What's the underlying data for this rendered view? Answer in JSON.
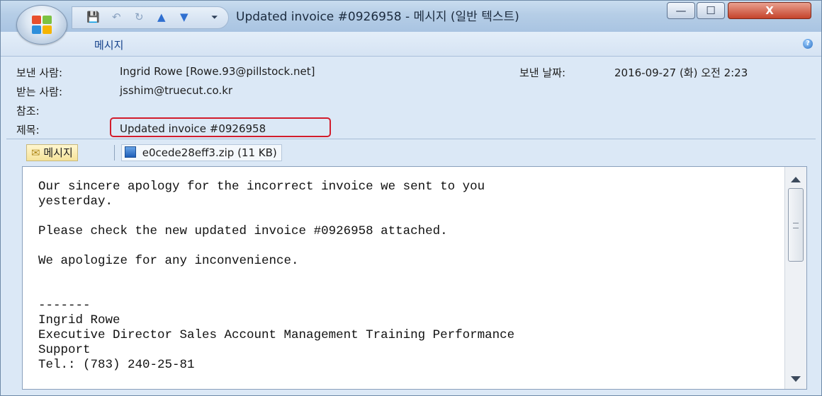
{
  "window": {
    "title": "Updated invoice #0926958 - 메시지 (일반 텍스트)",
    "minimize_glyph": "—",
    "maximize_glyph": "☐",
    "close_glyph": "X"
  },
  "quick_access": {
    "icons": [
      "save-icon",
      "undo-icon",
      "redo-icon",
      "previous-item-icon",
      "next-item-icon",
      "customize-icon"
    ]
  },
  "ribbon": {
    "tab": "메시지"
  },
  "header": {
    "from_label": "보낸 사람:",
    "from_value": "Ingrid Rowe [Rowe.93@pillstock.net]",
    "sent_label": "보낸 날짜:",
    "sent_value": "2016-09-27 (화) 오전 2:23",
    "to_label": "받는 사람:",
    "to_value": "jsshim@truecut.co.kr",
    "cc_label": "참조:",
    "subject_label": "제목:",
    "subject_value": "Updated invoice #0926958"
  },
  "attachments": {
    "message_tab": "메시지",
    "file": "e0cede28eff3.zip (11 KB)"
  },
  "body": {
    "text": "Our sincere apology for the incorrect invoice we sent to you\nyesterday.\n\nPlease check the new updated invoice #0926958 attached.\n\nWe apologize for any inconvenience.\n\n\n-------\nIngrid Rowe\nExecutive Director Sales Account Management Training Performance\nSupport\nTel.: (783) 240-25-81"
  },
  "colors": {
    "subject_highlight": "#d21c2c",
    "accent": "#15428b"
  }
}
